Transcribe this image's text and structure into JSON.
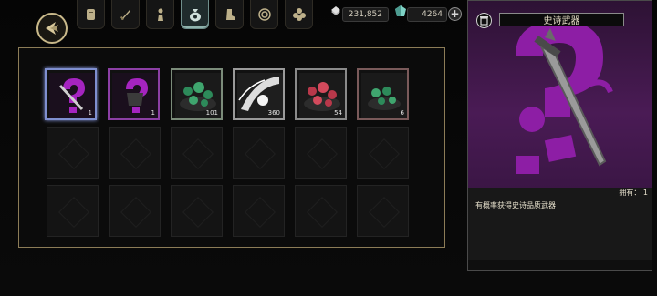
{
  "toolbar": {
    "tabs": [
      {
        "icon": "scroll-icon",
        "active": false
      },
      {
        "icon": "sword-icon",
        "active": false
      },
      {
        "icon": "figure-icon",
        "active": false
      },
      {
        "icon": "money-bag-icon",
        "active": true
      },
      {
        "icon": "boot-icon",
        "active": false
      },
      {
        "icon": "spiral-icon",
        "active": false
      },
      {
        "icon": "flower-icon",
        "active": false
      }
    ]
  },
  "currency": {
    "primary": "231,852",
    "secondary": "4264"
  },
  "inventory": {
    "items": [
      {
        "name": "epic-weapon-box",
        "count": "1"
      },
      {
        "name": "epic-armor-box",
        "count": "1"
      },
      {
        "name": "green-gems",
        "count": "101"
      },
      {
        "name": "white-orb",
        "count": "360"
      },
      {
        "name": "red-gems",
        "count": "54"
      },
      {
        "name": "green-gems-small",
        "count": "6"
      }
    ]
  },
  "detail": {
    "title": "史诗武器",
    "owned_label": "拥有： 1",
    "description": "有概率获得史诗品质武器"
  },
  "colors": {
    "epic_purple": "#8d1ea5",
    "gold_border": "#8c7c57"
  }
}
